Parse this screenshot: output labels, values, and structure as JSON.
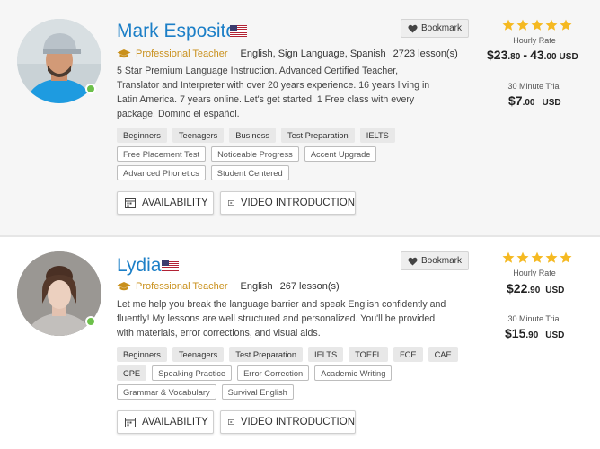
{
  "teachers": [
    {
      "name": "Mark Esposito",
      "flag": "us-flag-icon",
      "title": "Professional Teacher",
      "languages": "English, Sign Language, Spanish",
      "lessons": "2723 lesson(s)",
      "bio": "5 Star Premium Language Instruction. Advanced Certified Teacher, Translator and Interpreter with over 20 years experience. 16 years living in Latin America. 7 years online. Let's get started! 1 Free class with every package! Domino el español.",
      "tags_row1": [
        "Beginners",
        "Teenagers",
        "Business",
        "Test Preparation",
        "IELTS"
      ],
      "tags_row2": [
        "Free Placement Test",
        "Noticeable Progress",
        "Accent Upgrade"
      ],
      "tags_row3": [
        "Advanced Phonetics",
        "Student Centered"
      ],
      "bookmark": "Bookmark",
      "availability": "AVAILABILITY",
      "video": "VIDEO INTRODUCTION",
      "rating_stars": 5,
      "hourly_label": "Hourly Rate",
      "hourly_whole": "$23",
      "hourly_cents": ".80",
      "hourly_sep": "-",
      "hourly_whole2": "43",
      "hourly_cents2": ".00",
      "currency": "USD",
      "trial_label": "30 Minute Trial",
      "trial_whole": "$7",
      "trial_cents": ".00",
      "online": true
    },
    {
      "name": "Lydia",
      "flag": "us-flag-icon",
      "title": "Professional Teacher",
      "languages": "English",
      "lessons": "267 lesson(s)",
      "bio": "Let me help you break the language barrier and speak English confidently and fluently! My lessons are well structured and personalized. You'll be provided with materials, error corrections, and visual aids.",
      "tags_row1": [
        "Beginners",
        "Teenagers",
        "Test Preparation",
        "IELTS",
        "TOEFL",
        "FCE",
        "CAE"
      ],
      "tags_row2": [
        "CPE",
        "Speaking Practice",
        "Error Correction",
        "Academic Writing"
      ],
      "tags_row3": [
        "Grammar & Vocabulary",
        "Survival English"
      ],
      "bookmark": "Bookmark",
      "availability": "AVAILABILITY",
      "video": "VIDEO INTRODUCTION",
      "rating_stars": 5,
      "hourly_label": "Hourly Rate",
      "hourly_whole": "$22",
      "hourly_cents": ".90",
      "currency": "USD",
      "trial_label": "30 Minute Trial",
      "trial_whole": "$15",
      "trial_cents": ".90",
      "online": true
    }
  ],
  "colors": {
    "name": "#1c7fc7",
    "pro": "#c9901c",
    "star": "#f5b921",
    "online": "#6cc04a"
  }
}
